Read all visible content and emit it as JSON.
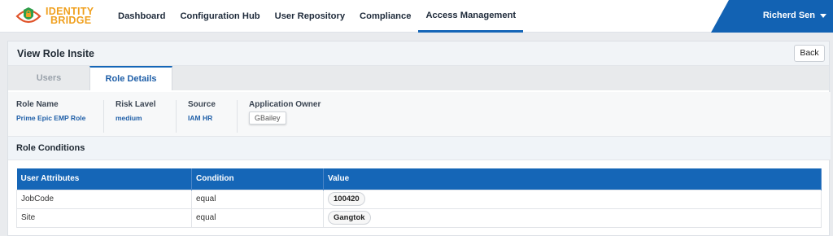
{
  "brand": {
    "line1": "IDENTITY",
    "line2": "BRIDGE",
    "logo_icon": "eye-lock-icon"
  },
  "nav": [
    {
      "label": "Dashboard",
      "active": false
    },
    {
      "label": "Configuration Hub",
      "active": false
    },
    {
      "label": "User Repository",
      "active": false
    },
    {
      "label": "Compliance",
      "active": false
    },
    {
      "label": "Access Management",
      "active": true
    }
  ],
  "user": {
    "name": "Richerd Sen",
    "menu_icon": "caret-down-icon"
  },
  "page": {
    "title": "View Role Insite",
    "back_label": "Back"
  },
  "tabs": [
    {
      "label": "Users",
      "active": false
    },
    {
      "label": "Role Details",
      "active": true
    }
  ],
  "details": {
    "role_name": {
      "label": "Role Name",
      "value": "Prime Epic EMP Role"
    },
    "risk_level": {
      "label": "Risk Lavel",
      "value": "medium"
    },
    "source": {
      "label": "Source",
      "value": "IAM HR"
    },
    "app_owner": {
      "label": "Application Owner",
      "value": "GBailey"
    }
  },
  "conditions": {
    "title": "Role Conditions",
    "columns": [
      "User Attributes",
      "Condition",
      "Value"
    ],
    "rows": [
      {
        "attribute": "JobCode",
        "condition": "equal",
        "value": "100420"
      },
      {
        "attribute": "Site",
        "condition": "equal",
        "value": "Gangtok"
      }
    ]
  },
  "colors": {
    "primary": "#1566b7",
    "brand_orange": "#f0a01e",
    "link_blue": "#1f5fa8"
  }
}
